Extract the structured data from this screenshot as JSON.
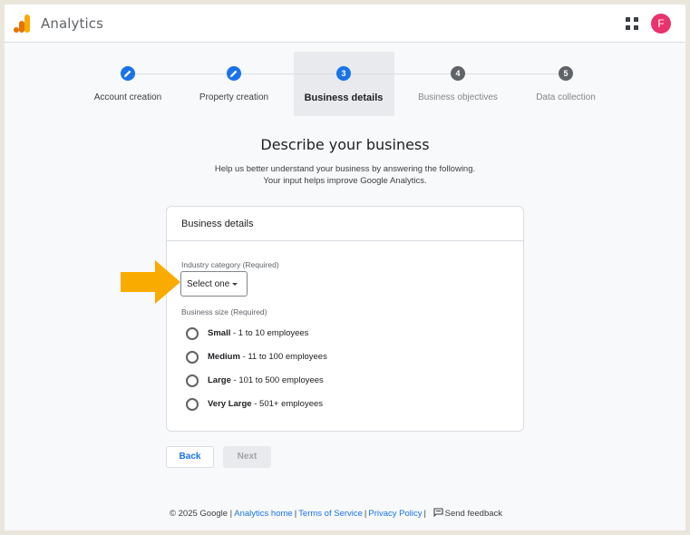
{
  "header": {
    "app_title": "Analytics",
    "avatar_letter": "F"
  },
  "stepper": {
    "steps": [
      {
        "number": "1",
        "label": "Account creation",
        "state": "done"
      },
      {
        "number": "2",
        "label": "Property creation",
        "state": "done"
      },
      {
        "number": "3",
        "label": "Business details",
        "state": "current"
      },
      {
        "number": "4",
        "label": "Business objectives",
        "state": "todo"
      },
      {
        "number": "5",
        "label": "Data collection",
        "state": "todo"
      }
    ]
  },
  "main": {
    "title": "Describe your business",
    "subtitle_line1": "Help us better understand your business by answering the following.",
    "subtitle_line2": "Your input helps improve Google Analytics."
  },
  "card": {
    "title": "Business details",
    "industry_label": "Industry category (Required)",
    "industry_value": "Select one",
    "size_label": "Business size (Required)",
    "size_options": [
      {
        "name": "Small",
        "detail": " - 1 to 10 employees"
      },
      {
        "name": "Medium",
        "detail": " - 11 to 100 employees"
      },
      {
        "name": "Large",
        "detail": " - 101 to 500 employees"
      },
      {
        "name": "Very Large",
        "detail": " - 501+ employees"
      }
    ]
  },
  "buttons": {
    "back": "Back",
    "next": "Next"
  },
  "footer": {
    "copyright": "© 2025 Google |",
    "analytics_home": "Analytics home",
    "terms": "Terms of Service",
    "privacy": "Privacy Policy",
    "feedback": "Send feedback"
  },
  "colors": {
    "accent": "#1a73e8",
    "avatar": "#e8336d",
    "arrow": "#f9ab00",
    "logo_orange": "#f9ab00",
    "logo_dark": "#e37400"
  }
}
